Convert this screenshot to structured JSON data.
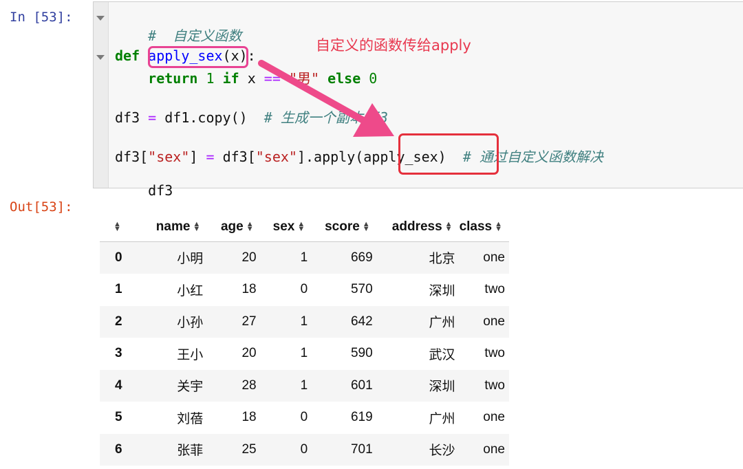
{
  "prompts": {
    "in": "In [53]:",
    "out": "Out[53]:"
  },
  "code": {
    "l1_comment": "#  自定义函数",
    "l2_def": "def",
    "l2_name": "apply_sex",
    "l2_rest": "(x):",
    "l3_return": "return",
    "l3_one": "1",
    "l3_if": "if",
    "l3_x": "x",
    "l3_eq": "==",
    "l3_str": "\"男\"",
    "l3_else": "else",
    "l3_zero": "0",
    "l4_var": "df3",
    "l4_eq": "=",
    "l4_call": "df1.copy()",
    "l4_comment": "# 生成一个副本df3",
    "l5_a": "df3[",
    "l5_s1": "\"sex\"",
    "l5_b": "]",
    "l5_eq": "=",
    "l5_c": "df3[",
    "l5_s2": "\"sex\"",
    "l5_d": "].apply(",
    "l5_arg": "apply_sex",
    "l5_e": ")",
    "l5_comment": "# 通过自定义函数解决",
    "l6": "df3"
  },
  "annotation": {
    "text": "自定义的函数传给apply",
    "arrow_color": "#ee4a8a"
  },
  "table": {
    "columns": [
      "name",
      "age",
      "sex",
      "score",
      "address",
      "class"
    ],
    "rows": [
      [
        "0",
        "小明",
        "20",
        "1",
        "669",
        "北京",
        "one"
      ],
      [
        "1",
        "小红",
        "18",
        "0",
        "570",
        "深圳",
        "two"
      ],
      [
        "2",
        "小孙",
        "27",
        "1",
        "642",
        "广州",
        "one"
      ],
      [
        "3",
        "王小",
        "20",
        "1",
        "590",
        "武汉",
        "two"
      ],
      [
        "4",
        "关宇",
        "28",
        "1",
        "601",
        "深圳",
        "two"
      ],
      [
        "5",
        "刘蓓",
        "18",
        "0",
        "619",
        "广州",
        "one"
      ],
      [
        "6",
        "张菲",
        "25",
        "0",
        "701",
        "长沙",
        "one"
      ]
    ]
  },
  "icons": {
    "sort": "sort-icon",
    "fold": "fold-arrow-icon"
  }
}
